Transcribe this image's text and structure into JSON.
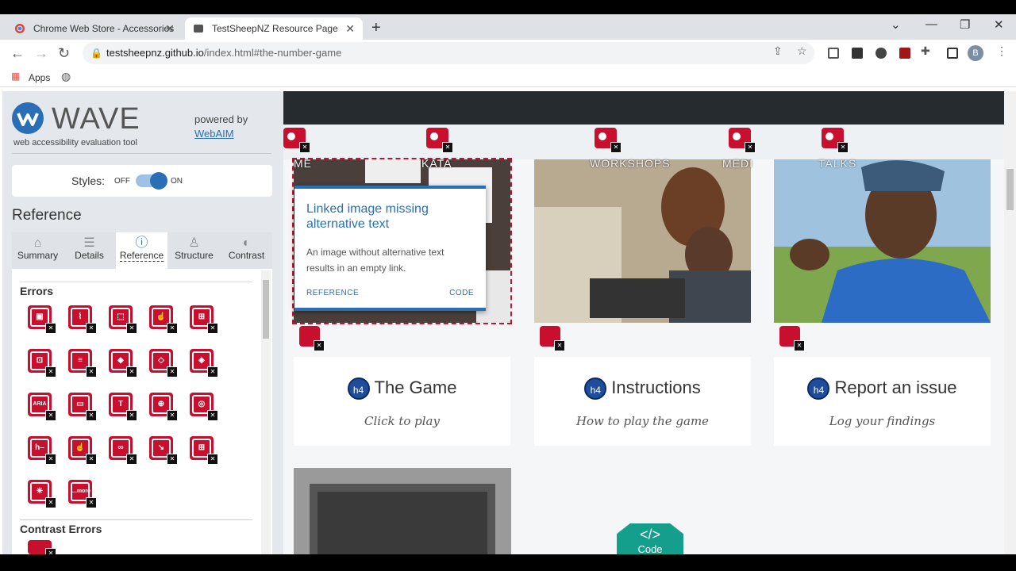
{
  "browser": {
    "tabs": [
      {
        "title": "Chrome Web Store - Accessories",
        "active": false
      },
      {
        "title": "TestSheepNZ Resource Page",
        "active": true
      }
    ],
    "url": {
      "host": "testsheepnz.github.io",
      "path": "/index.html#the-number-game"
    },
    "bookmarks": {
      "apps_label": "Apps"
    },
    "profile_initial": "B"
  },
  "wave": {
    "title": "WAVE",
    "subtitle": "web accessibility evaluation tool",
    "powered_by": "powered by",
    "webaim": "WebAIM",
    "styles_label": "Styles:",
    "styles_off": "OFF",
    "styles_on": "ON",
    "section_heading": "Reference",
    "tabs": [
      {
        "label": "Summary",
        "icon": "home-icon"
      },
      {
        "label": "Details",
        "icon": "list-icon"
      },
      {
        "label": "Reference",
        "icon": "info-icon",
        "active": true
      },
      {
        "label": "Structure",
        "icon": "hierarchy-icon"
      },
      {
        "label": "Contrast",
        "icon": "contrast-icon"
      }
    ],
    "errors_title": "Errors",
    "contrast_title": "Contrast Errors",
    "error_icon_glyphs": [
      "▣",
      "⌇",
      "⬚",
      "☝",
      "⊞",
      "⊡",
      "≡",
      "◆",
      "◇",
      "◈",
      "ARIA",
      "▭",
      "T",
      "⊕",
      "◎",
      "h–",
      "☝",
      "∞",
      "↘",
      "⊞",
      "✳",
      "...more"
    ],
    "error_color": "#c8102e"
  },
  "page": {
    "nav_items": [
      "ME",
      "KATA",
      "WORKSHOPS",
      "MEDI",
      "TALKS"
    ],
    "cards": [
      {
        "heading": "The Game",
        "sub": "Click to play"
      },
      {
        "heading": "Instructions",
        "sub": "How to play the game"
      },
      {
        "heading": "Report an issue",
        "sub": "Log your findings"
      }
    ],
    "h4_badge": "h4",
    "code_button": {
      "icon": "</>",
      "label": "Code"
    },
    "tooltip": {
      "title": "Linked image missing alternative text",
      "description": "An image without alternative text results in an empty link.",
      "reference": "REFERENCE",
      "code": "CODE"
    }
  }
}
